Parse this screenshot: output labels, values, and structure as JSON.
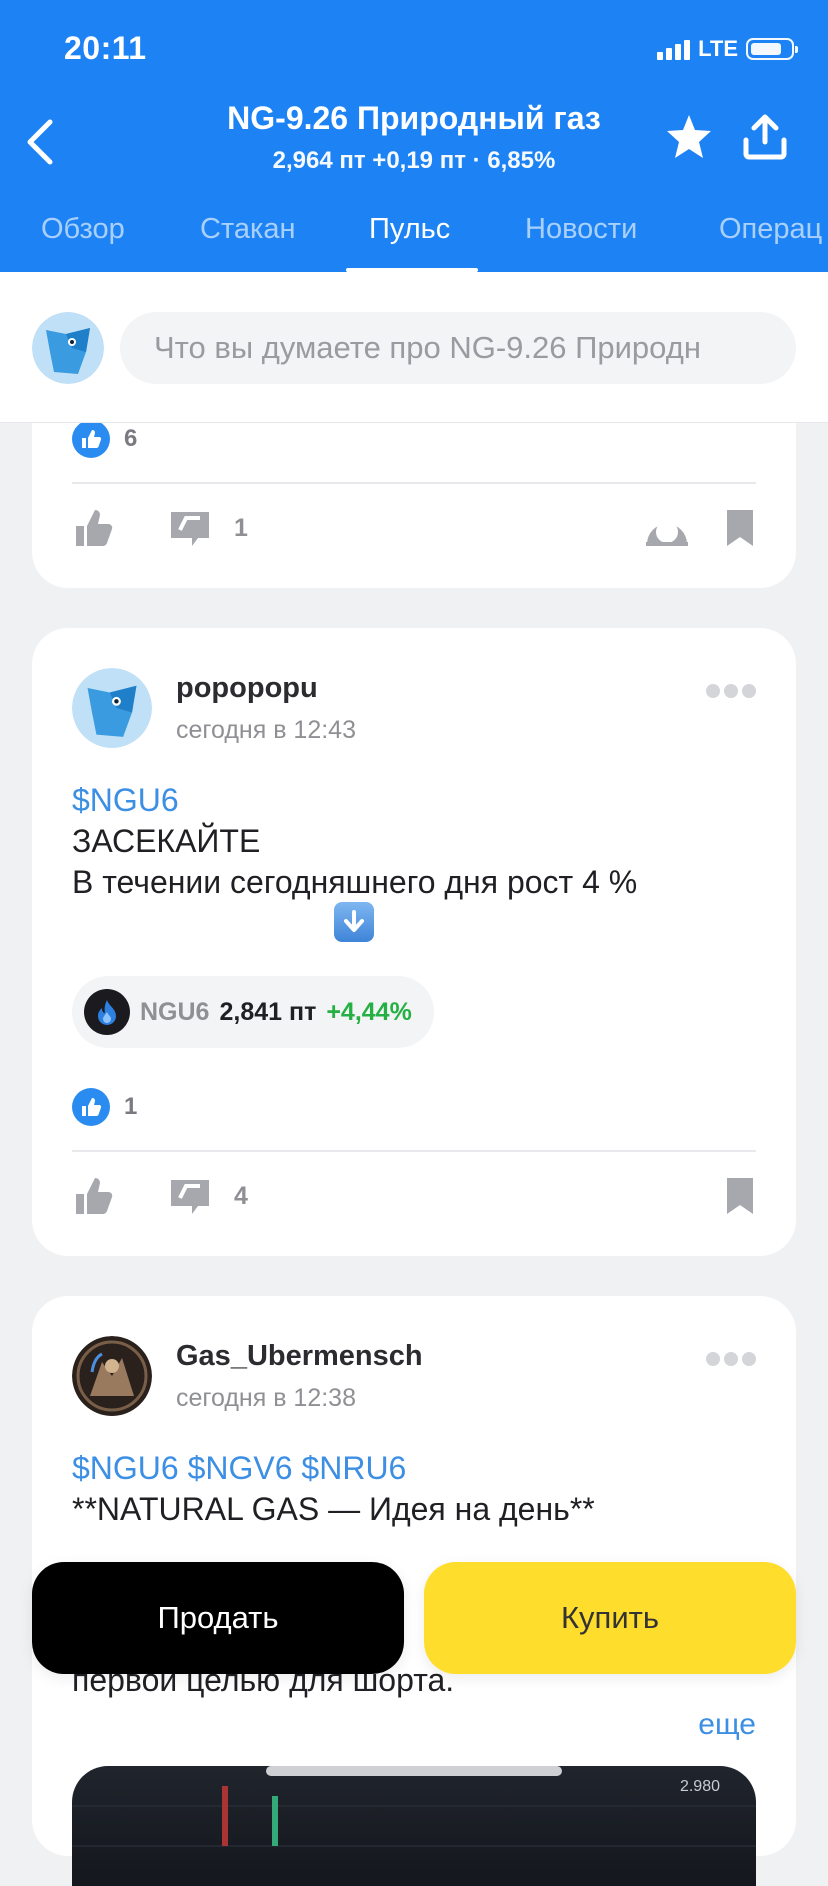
{
  "status_bar": {
    "time": "20:11",
    "network": "LTE"
  },
  "header": {
    "title": "NG-9.26 Природный газ",
    "subtitle": "2,964 пт  +0,19 пт · 6,85%",
    "tabs": [
      {
        "label": "Обзор"
      },
      {
        "label": "Стакан"
      },
      {
        "label": "Пульс"
      },
      {
        "label": "Новости"
      },
      {
        "label": "Операц"
      }
    ],
    "active_tab": "Пульс"
  },
  "composer": {
    "placeholder": "Что вы думаете про NG-9.26 Природн"
  },
  "posts": [
    {
      "likes": "6",
      "comments": "1"
    },
    {
      "author": "popopopu",
      "time": "сегодня в 12:43",
      "ticker_line": "$NGU6",
      "line2": "ЗАСЕКАЙТЕ",
      "line3": "В течении сегодняшнего дня рост 4 %",
      "instrument": {
        "ticker": "NGU6",
        "price": "2,841 пт",
        "change": "+4,44%"
      },
      "likes": "1",
      "comments": "4"
    },
    {
      "author": "Gas_Ubermensch",
      "time": "сегодня в 12:38",
      "tickers": "$NGU6 $NGV6 $NRU6",
      "line2": "**NATURAL GAS — Идея на день**",
      "line3_partial": "первой целью для шорта.",
      "more_label": "еще",
      "chart_label": "2.980"
    }
  ],
  "actions": {
    "sell_label": "Продать",
    "buy_label": "Купить"
  },
  "colors": {
    "header_bg": "#1d83f5",
    "buy": "#ffdd2d",
    "sell": "#000000",
    "positive": "#25b043",
    "link": "#3d8fe4"
  }
}
